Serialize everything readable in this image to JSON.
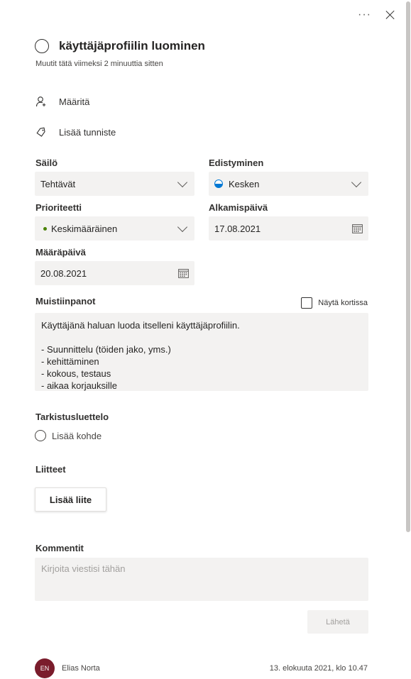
{
  "header": {
    "more_label": "···"
  },
  "task": {
    "title": "käyttäjäprofiilin luominen",
    "modified": "Muutit tätä viimeksi 2 minuuttia sitten"
  },
  "actions": {
    "assign": "Määritä",
    "add_tag": "Lisää tunniste"
  },
  "fields": {
    "bucket": {
      "label": "Säilö",
      "value": "Tehtävät"
    },
    "progress": {
      "label": "Edistyminen",
      "value": "Kesken"
    },
    "priority": {
      "label": "Prioriteetti",
      "value": "Keskimääräinen"
    },
    "start_date": {
      "label": "Alkamispäivä",
      "value": "17.08.2021"
    },
    "due_date": {
      "label": "Määräpäivä",
      "value": "20.08.2021"
    }
  },
  "notes": {
    "label": "Muistiinpanot",
    "show_on_card": "Näytä kortissa",
    "lines": [
      "Käyttäjänä haluan luoda itselleni käyttäjäprofiilin.",
      "",
      "- Suunnittelu (töiden jako, yms.)",
      "- kehittäminen",
      "- kokous, testaus",
      "- aikaa korjauksille"
    ]
  },
  "checklist": {
    "label": "Tarkistusluettelo",
    "add_item": "Lisää kohde"
  },
  "attachments": {
    "label": "Liitteet",
    "add_button": "Lisää liite"
  },
  "comments": {
    "label": "Kommentit",
    "placeholder": "Kirjoita viestisi tähän",
    "send": "Lähetä",
    "author_initials": "EN",
    "author": "Elias Norta",
    "timestamp": "13. elokuuta 2021, klo 10.47"
  },
  "colors": {
    "avatar": "#7a1c2c",
    "priority_dot": "#498205",
    "progress_icon": "#0078d4",
    "field_bg": "#f3f2f1"
  }
}
